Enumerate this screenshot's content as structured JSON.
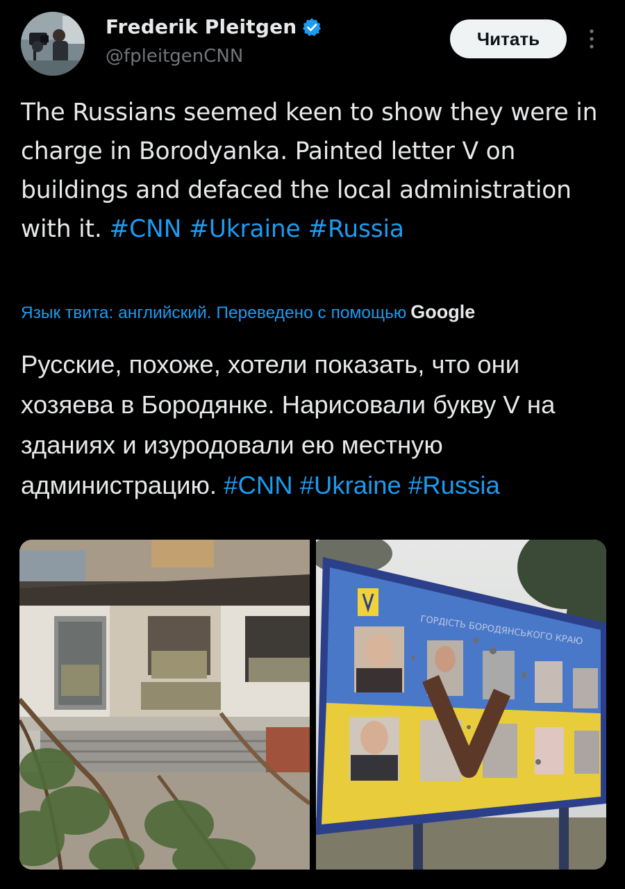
{
  "author": {
    "display_name": "Frederik Pleitgen",
    "handle": "@fpleitgenCNN",
    "verified": true
  },
  "actions": {
    "read_label": "Читать"
  },
  "icons": {
    "verified": "verified-badge-icon",
    "more": "vertical-ellipsis-icon"
  },
  "tweet": {
    "text_plain": "The Russians seemed keen to show they were in charge in Borodyanka. Painted letter V on buildings and defaced the local administration with it.",
    "hashtags": [
      "#CNN",
      "#Ukraine",
      "#Russia"
    ]
  },
  "translation": {
    "notice": "Язык твита: английский. Переведено с помощью",
    "provider": "Google",
    "text_plain": "Русские, похоже, хотели показать, что они хозяева в Бородянке. Нарисовали букву V на зданиях и изуродовали ею местную администрацию.",
    "hashtags": [
      "#CNN",
      "#Ukraine",
      "#Russia"
    ]
  },
  "media": {
    "left_photo_sign": "",
    "right_photo_sign": "ГОРДІСТЬ БОРОДЯНСЬКОГО КРАЮ",
    "right_photo_mark": "V"
  },
  "colors": {
    "background": "#000000",
    "text": "#e7e9ea",
    "secondary": "#71767b",
    "link": "#1d9bf0",
    "button_bg": "#eff3f4"
  }
}
